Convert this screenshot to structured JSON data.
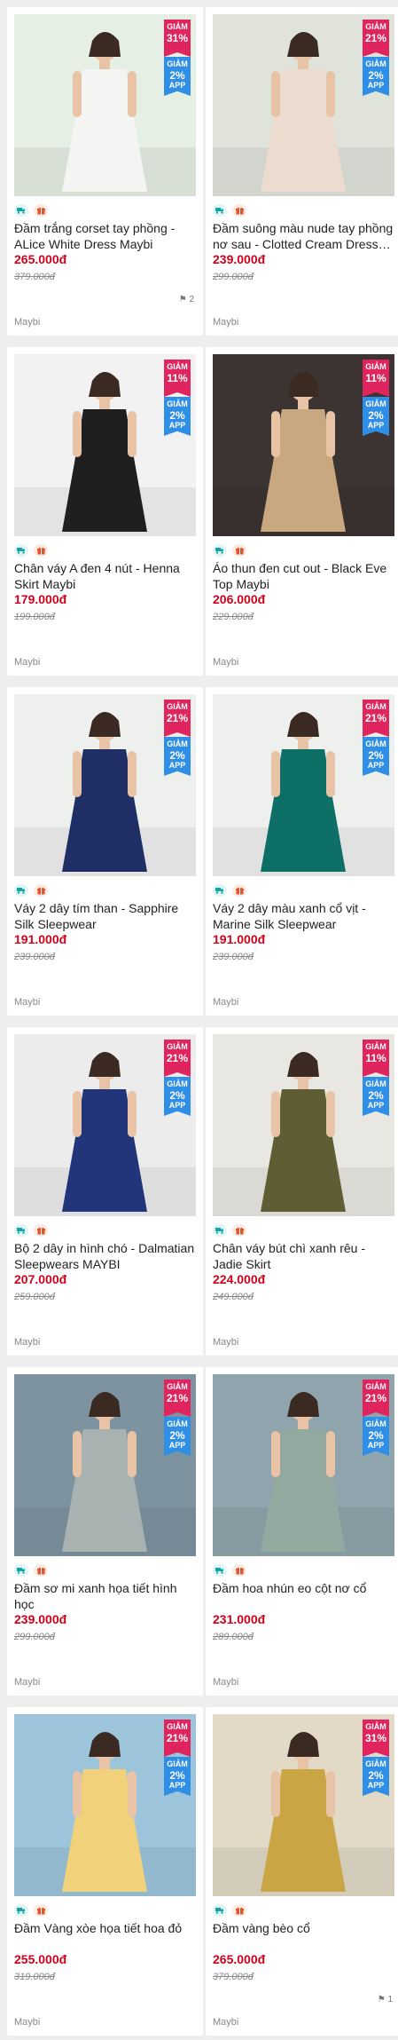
{
  "products": [
    {
      "title": "Đầm trắng corset tay phồng - ALice White Dress Maybi",
      "price": "265.000đ",
      "old_price": "379.000đ",
      "sale_line1": "GIẢM",
      "sale_pct": "31%",
      "app_line1": "GIẢM",
      "app_pct": "2%",
      "app_line3": "APP",
      "brand": "Maybi",
      "tag_count": "2",
      "bg": "#e6efe3",
      "garment": "#f4f4f2"
    },
    {
      "title": "Đầm suông màu nude tay phồng nơ sau - Clotted Cream Dress Maybi",
      "price": "239.000đ",
      "old_price": "299.000đ",
      "sale_line1": "GIẢM",
      "sale_pct": "21%",
      "app_line1": "GIẢM",
      "app_pct": "2%",
      "app_line3": "APP",
      "brand": "Maybi",
      "tag_count": "",
      "bg": "#dfe3da",
      "garment": "#ecdcd0"
    },
    {
      "title": "Chân váy A đen 4 nút - Henna Skirt Maybi",
      "price": "179.000đ",
      "old_price": "199.000đ",
      "sale_line1": "GIẢM",
      "sale_pct": "11%",
      "app_line1": "GIẢM",
      "app_pct": "2%",
      "app_line3": "APP",
      "brand": "Maybi",
      "tag_count": "",
      "bg": "#f2f2f2",
      "garment": "#1f1f1f"
    },
    {
      "title": "Áo thun đen cut out - Black Eve Top Maybi",
      "price": "206.000đ",
      "old_price": "229.000đ",
      "sale_line1": "GIẢM",
      "sale_pct": "11%",
      "app_line1": "GIẢM",
      "app_pct": "2%",
      "app_line3": "APP",
      "brand": "Maybi",
      "tag_count": "",
      "bg": "#3b3432",
      "garment": "#c9a77f"
    },
    {
      "title": "Váy 2 dây tím than - Sapphire Silk Sleepwear",
      "price": "191.000đ",
      "old_price": "239.000đ",
      "sale_line1": "GIẢM",
      "sale_pct": "21%",
      "app_line1": "GIẢM",
      "app_pct": "2%",
      "app_line3": "APP",
      "brand": "Maybi",
      "tag_count": "",
      "bg": "#eef0ee",
      "garment": "#1f2f66"
    },
    {
      "title": "Váy 2 dây màu xanh cổ vịt - Marine Silk Sleepwear",
      "price": "191.000đ",
      "old_price": "239.000đ",
      "sale_line1": "GIẢM",
      "sale_pct": "21%",
      "app_line1": "GIẢM",
      "app_pct": "2%",
      "app_line3": "APP",
      "brand": "Maybi",
      "tag_count": "",
      "bg": "#eef0ee",
      "garment": "#0d6f66"
    },
    {
      "title": "Bộ 2 dây in hình chó - Dalmatian Sleepwears MAYBI",
      "price": "207.000đ",
      "old_price": "259.000đ",
      "sale_line1": "GIẢM",
      "sale_pct": "21%",
      "app_line1": "GIẢM",
      "app_pct": "2%",
      "app_line3": "APP",
      "brand": "Maybi",
      "tag_count": "",
      "bg": "#ececec",
      "garment": "#22357a"
    },
    {
      "title": "Chân váy bút chì xanh rêu - Jadie Skirt",
      "price": "224.000đ",
      "old_price": "249.000đ",
      "sale_line1": "GIẢM",
      "sale_pct": "11%",
      "app_line1": "GIẢM",
      "app_pct": "2%",
      "app_line3": "APP",
      "brand": "Maybi",
      "tag_count": "",
      "bg": "#e9e7e2",
      "garment": "#5f5d33"
    },
    {
      "title": "Đầm sơ mi xanh họa tiết hình học",
      "price": "239.000đ",
      "old_price": "299.000đ",
      "sale_line1": "GIẢM",
      "sale_pct": "21%",
      "app_line1": "GIẢM",
      "app_pct": "2%",
      "app_line3": "APP",
      "brand": "Maybi",
      "tag_count": "",
      "bg": "#7d93a0",
      "garment": "#a8b2b0"
    },
    {
      "title": "Đầm hoa nhún eo cột nơ cổ",
      "price": "231.000đ",
      "old_price": "289.000đ",
      "sale_line1": "GIẢM",
      "sale_pct": "21%",
      "app_line1": "GIẢM",
      "app_pct": "2%",
      "app_line3": "APP",
      "brand": "Maybi",
      "tag_count": "",
      "bg": "#8fa4ad",
      "garment": "#93a9a0"
    },
    {
      "title": "Đầm Vàng xòe họa tiết hoa đỏ",
      "price": "255.000đ",
      "old_price": "319.000đ",
      "sale_line1": "GIẢM",
      "sale_pct": "21%",
      "app_line1": "GIẢM",
      "app_pct": "2%",
      "app_line3": "APP",
      "brand": "Maybi",
      "tag_count": "",
      "bg": "#9cc4db",
      "garment": "#f1d27a"
    },
    {
      "title": "Đầm vàng bèo cổ",
      "price": "265.000đ",
      "old_price": "379.000đ",
      "sale_line1": "GIẢM",
      "sale_pct": "31%",
      "app_line1": "GIẢM",
      "app_pct": "2%",
      "app_line3": "APP",
      "brand": "Maybi",
      "tag_count": "1",
      "bg": "#e2d9c7",
      "garment": "#c9a543"
    }
  ],
  "icons": {
    "ship": "truck-icon",
    "gift": "gift-icon"
  },
  "colors": {
    "price": "#d0021b",
    "sale_badge": "#e0245e",
    "app_badge": "#2f8fe6"
  }
}
